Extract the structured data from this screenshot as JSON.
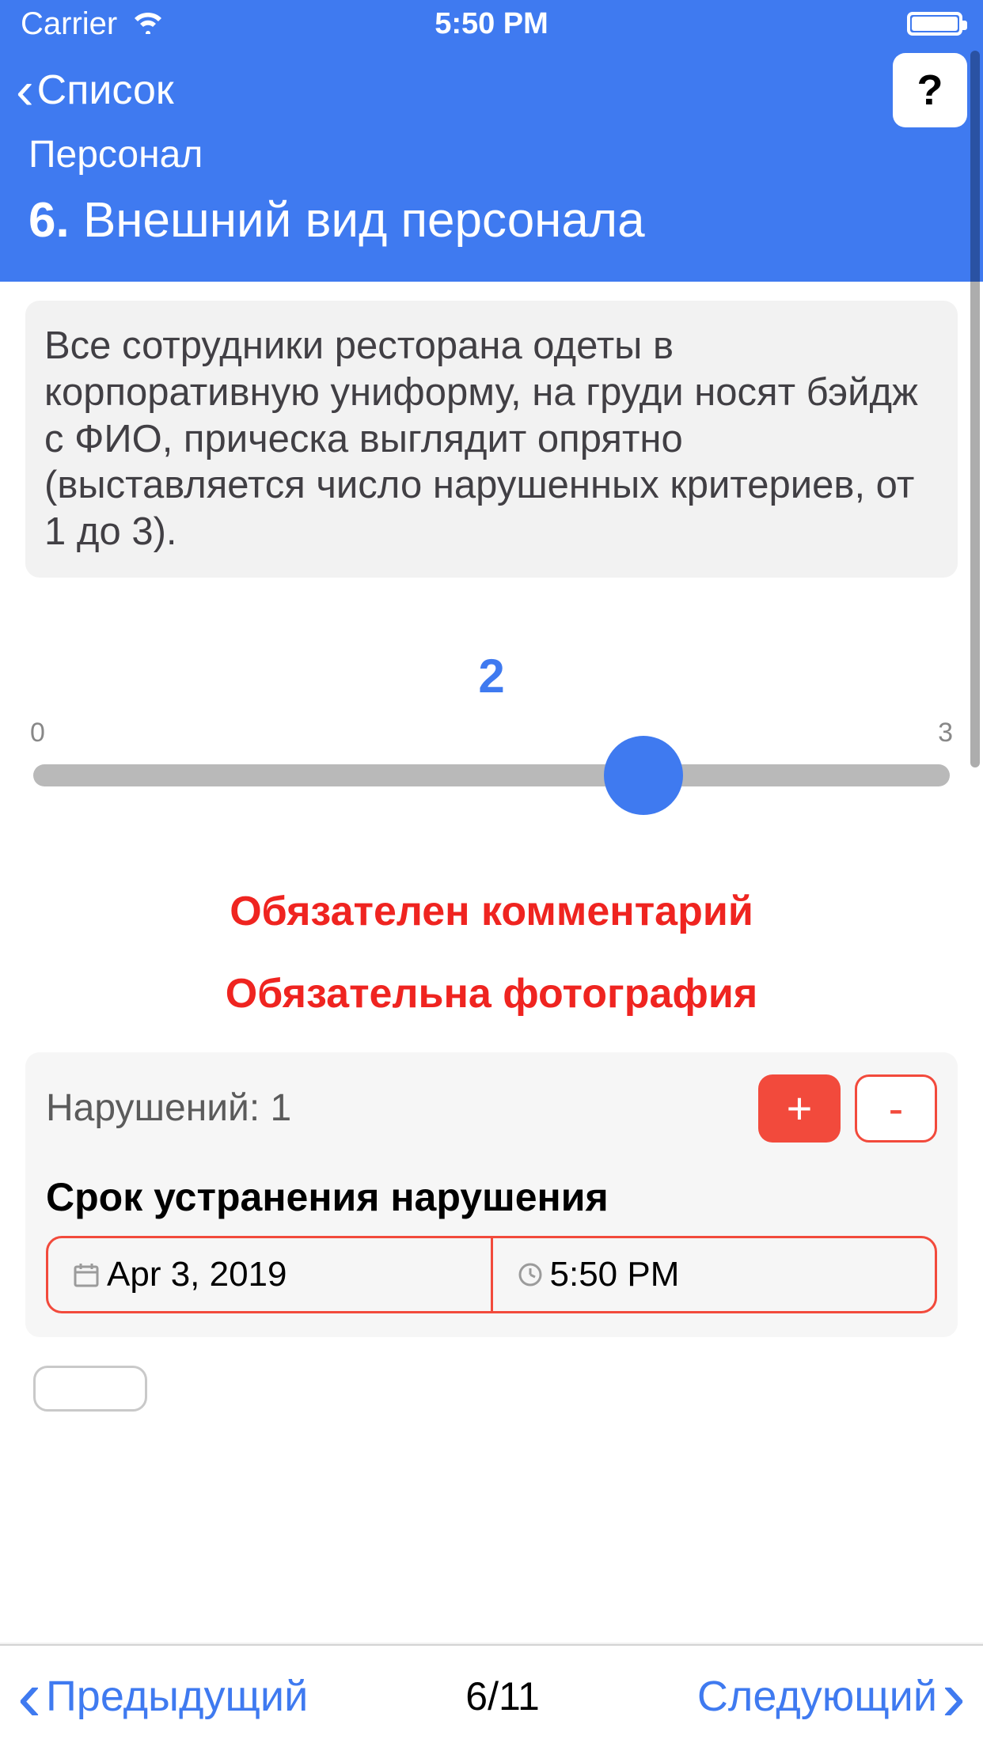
{
  "status_bar": {
    "carrier": "Carrier",
    "time": "5:50 PM"
  },
  "nav": {
    "back_label": "Список",
    "help_label": "?"
  },
  "header": {
    "category": "Персонал",
    "question_number": "6.",
    "question_title": "Внешний вид персонала"
  },
  "description": "Все сотрудники ресторана одеты в корпоративную униформу, на груди носят бэйдж с ФИО, прическа выглядит опрятно (выставляется число нарушенных критериев, от 1 до 3).",
  "slider": {
    "value": "2",
    "min_label": "0",
    "max_label": "3"
  },
  "warnings": {
    "comment_required": "Обязателен комментарий",
    "photo_required": "Обязательна фотография"
  },
  "violations": {
    "label": "Нарушений: 1",
    "plus": "+",
    "minus": "-",
    "deadline_label": "Срок устранения нарушения",
    "date": "Apr 3, 2019",
    "time": "5:50 PM"
  },
  "footer": {
    "prev": "Предыдущий",
    "counter": "6/11",
    "next": "Следующий"
  }
}
